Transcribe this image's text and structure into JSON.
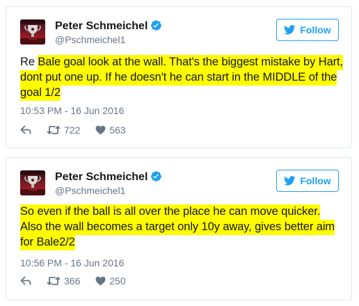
{
  "tweets": [
    {
      "display_name": "Peter Schmeichel",
      "handle": "@Pschmeichel1",
      "follow_label": "Follow",
      "text_lines": [
        {
          "plain": "Re ",
          "highlighted": "Bale goal look at the wall. That's the biggest mistake by Hart,"
        },
        {
          "plain": "",
          "highlighted": "dont put one up. If he doesn't he can start in the MIDDLE of the"
        },
        {
          "plain": "",
          "highlighted": "goal 1/2"
        }
      ],
      "timestamp": "10:53 PM - 16 Jun 2016",
      "retweets": "722",
      "likes": "563"
    },
    {
      "display_name": "Peter Schmeichel",
      "handle": "@Pschmeichel1",
      "follow_label": "Follow",
      "text_lines": [
        {
          "plain": "",
          "highlighted": "So even if the ball is all over the place he can move quicker."
        },
        {
          "plain": "",
          "highlighted": "Also the wall becomes a target only 10y away, gives better aim"
        },
        {
          "plain": "",
          "highlighted": "for Bale2/2"
        }
      ],
      "timestamp": "10:56 PM - 16 Jun 2016",
      "retweets": "366",
      "likes": "250"
    }
  ],
  "colors": {
    "twitter_blue": "#1da1f2",
    "highlight": "#fffb00",
    "secondary_text": "#657786",
    "primary_text": "#14171a",
    "card_border": "#e1e8ed"
  },
  "icons": {
    "avatar": "premier-league-trophy-avatar",
    "verified": "verified-badge-icon",
    "follow": "twitter-bird-icon",
    "reply": "reply-icon",
    "retweet": "retweet-icon",
    "like": "heart-icon"
  }
}
